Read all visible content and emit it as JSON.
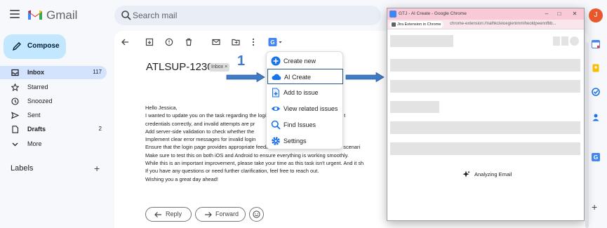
{
  "gmail": {
    "brand": "Gmail",
    "search_placeholder": "Search mail",
    "compose_label": "Compose",
    "nav": [
      {
        "label": "Inbox",
        "count": "117"
      },
      {
        "label": "Starred",
        "count": ""
      },
      {
        "label": "Snoozed",
        "count": ""
      },
      {
        "label": "Sent",
        "count": ""
      },
      {
        "label": "Drafts",
        "count": "2"
      },
      {
        "label": "More",
        "count": ""
      }
    ],
    "labels_title": "Labels"
  },
  "email": {
    "subject": "ATLSUP-1230",
    "inbox_chip": "Inbox ×",
    "lines": [
      "Hello Jessica,",
      "I wanted to update you on the task regarding the login page on our mobile app, for the t",
      "credentials correctly, and invalid attempts are pr                                error handling. W",
      "Add server-side validation to check whether the                               correct.",
      "Implement clear error messages for invalid login",
      "Ensure that the login page provides appropriate feedback for both success and failure scenari",
      "Make sure to test this on both iOS and Android to ensure everything is working smoothly.",
      "While this is an important improvement, please take your time as this task isn't urgent. And it sh",
      "If you have any questions or need further clarification, feel free to reach out.",
      "Wishing you a great day ahead!"
    ],
    "reply_label": "Reply",
    "forward_label": "Forward"
  },
  "annotation": {
    "step": "1"
  },
  "dropdown": {
    "items": [
      {
        "label": "Create new",
        "icon": "plus-circle-icon"
      },
      {
        "label": "AI Create",
        "icon": "ai-cloud-icon"
      },
      {
        "label": "Add to issue",
        "icon": "document-plus-icon"
      },
      {
        "label": "View related issues",
        "icon": "eye-icon"
      },
      {
        "label": "Find Issues",
        "icon": "search-icon"
      },
      {
        "label": "Settings",
        "icon": "gear-icon"
      }
    ],
    "selected": "AI Create"
  },
  "popup": {
    "title": "GTJ - AI Create - Google Chrome",
    "url_chip": "Jira Extension in Chrome",
    "url": "chrome-extension://nalhkcleioegienimmiheoldpeennfbb...",
    "status": "Analyzing Email"
  },
  "profile": {
    "initial": "J"
  },
  "colors": {
    "accent": "#0b57d0",
    "compose_bg": "#c2e7ff",
    "popup_title_bg": "#f8c9d6",
    "avatar": "#e8582c"
  }
}
